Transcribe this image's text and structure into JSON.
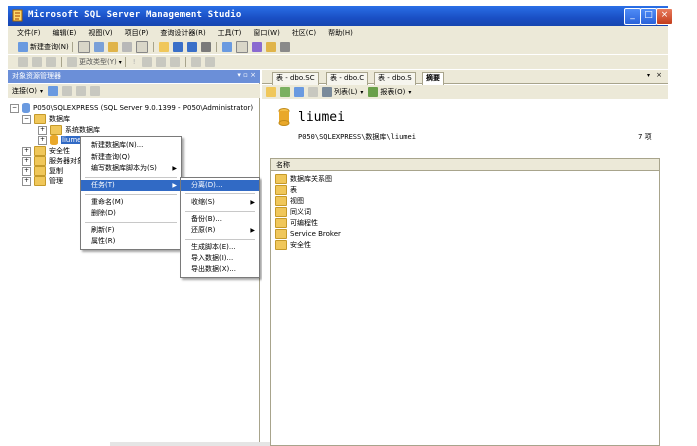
{
  "window": {
    "title": "Microsoft SQL Server Management Studio"
  },
  "menu": [
    "文件(F)",
    "编辑(E)",
    "视图(V)",
    "项目(P)",
    "查询设计器(R)",
    "工具(T)",
    "窗口(W)",
    "社区(C)",
    "帮助(H)"
  ],
  "toolbar": {
    "new_query": "新建查询(N)",
    "change_type": "更改类型(Y)"
  },
  "object_explorer": {
    "title": "对象资源管理器",
    "connect": "连接(O)",
    "pin": "▾ ▫ ×",
    "tree": {
      "server": "P050\\SQLEXPRESS (SQL Server 9.0.1399 - P050\\Administrator)",
      "databases": "数据库",
      "system_databases": "系统数据库",
      "selected_db": "liumei",
      "security": "安全性",
      "server_objects": "服务器对象",
      "replication": "复制",
      "management": "管理"
    }
  },
  "context_menu": {
    "items": [
      {
        "label": "新建数据库(N)..."
      },
      {
        "label": "新建查询(Q)"
      },
      {
        "label": "编写数据库脚本为(S)"
      },
      {
        "label": "任务(T)"
      },
      {
        "label": "重命名(M)"
      },
      {
        "label": "删除(D)"
      },
      {
        "label": "刷新(F)"
      },
      {
        "label": "属性(R)"
      }
    ]
  },
  "submenu": {
    "items": [
      {
        "label": "分离(D)..."
      },
      {
        "label": "收缩(S)"
      },
      {
        "label": "备份(B)..."
      },
      {
        "label": "还原(R)"
      },
      {
        "label": "生成脚本(E)..."
      },
      {
        "label": "导入数据(I)..."
      },
      {
        "label": "导出数据(X)..."
      }
    ]
  },
  "tabs": [
    "表 - dbo.SC",
    "表 - dbo.C",
    "表 - dbo.S",
    "摘要"
  ],
  "summary": {
    "list_label": "列表(L)",
    "report_label": "报表(O)",
    "db_name": "liumei",
    "path": "P050\\SQLEXPRESS\\数据库\\liumei",
    "item_count": "7 项",
    "column_header": "名称",
    "items": [
      "数据库关系图",
      "表",
      "视图",
      "同义词",
      "可编程性",
      "Service Broker",
      "安全性"
    ]
  },
  "colors": {
    "titlebar": "#1a4fc4",
    "highlight": "#316ac5",
    "chrome": "#ece9d8"
  }
}
